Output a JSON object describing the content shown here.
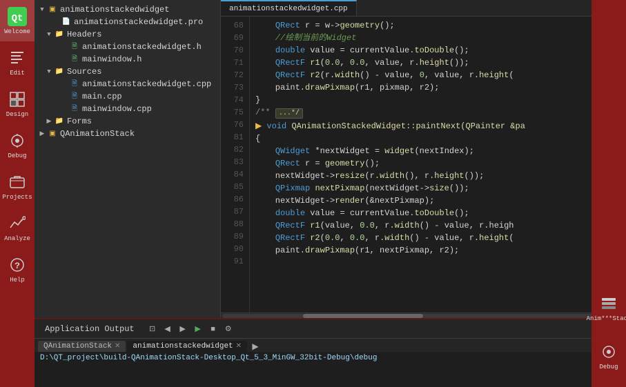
{
  "sidebar": {
    "items": [
      {
        "label": "Welcome",
        "icon": "qt-logo"
      },
      {
        "label": "Edit",
        "icon": "edit-icon"
      },
      {
        "label": "Design",
        "icon": "design-icon"
      },
      {
        "label": "Debug",
        "icon": "debug-icon"
      },
      {
        "label": "Projects",
        "icon": "projects-icon"
      },
      {
        "label": "Analyze",
        "icon": "analyze-icon"
      },
      {
        "label": "Help",
        "icon": "help-icon"
      }
    ]
  },
  "fileTree": {
    "items": [
      {
        "label": "animationstackedwidget",
        "type": "project",
        "depth": 0,
        "expanded": true,
        "arrow": "▼"
      },
      {
        "label": "animationstackedwidget.pro",
        "type": "pro",
        "depth": 1,
        "expanded": false,
        "arrow": ""
      },
      {
        "label": "Headers",
        "type": "folder",
        "depth": 1,
        "expanded": true,
        "arrow": "▼"
      },
      {
        "label": "animationstackedwidget.h",
        "type": "h",
        "depth": 2,
        "expanded": false,
        "arrow": ""
      },
      {
        "label": "mainwindow.h",
        "type": "h",
        "depth": 2,
        "expanded": false,
        "arrow": ""
      },
      {
        "label": "Sources",
        "type": "folder",
        "depth": 1,
        "expanded": true,
        "arrow": "▼"
      },
      {
        "label": "animationstackedwidget.cpp",
        "type": "cpp",
        "depth": 2,
        "expanded": false,
        "arrow": ""
      },
      {
        "label": "main.cpp",
        "type": "cpp",
        "depth": 2,
        "expanded": false,
        "arrow": ""
      },
      {
        "label": "mainwindow.cpp",
        "type": "cpp",
        "depth": 2,
        "expanded": false,
        "arrow": ""
      },
      {
        "label": "Forms",
        "type": "folder",
        "depth": 1,
        "expanded": false,
        "arrow": "▶"
      },
      {
        "label": "QAnimationStack",
        "type": "project",
        "depth": 0,
        "expanded": false,
        "arrow": "▶"
      }
    ]
  },
  "editor": {
    "activeTab": "animationstackedwidget.cpp",
    "tabs": [
      "animationstackedwidget.cpp"
    ],
    "lines": [
      {
        "num": 68,
        "code": "    QRect r = w->geometry();"
      },
      {
        "num": 69,
        "code": "    //绘制当前的Widget",
        "comment": true
      },
      {
        "num": 70,
        "code": "    double value = currentValue.toDouble();"
      },
      {
        "num": 71,
        "code": "    QRectF r1(0.0, 0.0, value, r.height());"
      },
      {
        "num": 72,
        "code": "    QRectF r2(r.width() - value, 0, value, r.height("
      },
      {
        "num": 73,
        "code": "    paint.drawPixmap(r1, pixmap, r2);"
      },
      {
        "num": 74,
        "code": "}"
      },
      {
        "num": 75,
        "code": ""
      },
      {
        "num": 76,
        "code": "/**",
        "fold": true,
        "foldLabel": "...*/"
      },
      {
        "num": 81,
        "code": "▶ void QAnimationStackedWidget::paintNext(QPainter &pa"
      },
      {
        "num": 82,
        "code": "{"
      },
      {
        "num": 83,
        "code": "    QWidget *nextWidget = widget(nextIndex);"
      },
      {
        "num": 84,
        "code": "    QRect r = geometry();"
      },
      {
        "num": 85,
        "code": "    nextWidget->resize(r.width(), r.height());"
      },
      {
        "num": 86,
        "code": "    QPixmap nextPixmap(nextWidget->size());"
      },
      {
        "num": 87,
        "code": "    nextWidget->render(&nextPixmap);"
      },
      {
        "num": 88,
        "code": "    double value = currentValue.toDouble();"
      },
      {
        "num": 89,
        "code": "    QRectF r1(value, 0.0, r.width() - value, r.heigh"
      },
      {
        "num": 90,
        "code": "    QRectF r2(0.0, 0.0, r.width() - value, r.height("
      },
      {
        "num": 91,
        "code": "    paint.drawPixmap(r1, nextPixmap, r2);"
      }
    ]
  },
  "outputPanel": {
    "title": "Application Output",
    "tabs": [
      {
        "label": "QAnimationStack",
        "active": false
      },
      {
        "label": "animationstackedwidget",
        "active": true
      }
    ],
    "content": "D:\\QT_project\\build-QAnimationStack-Desktop_Qt_5_3_MinGW_32bit-Debug\\debug"
  },
  "bottomSidebar": {
    "items": [
      {
        "label": "Anim***Stack",
        "icon": "anim-icon"
      },
      {
        "label": "Debug",
        "icon": "debug-icon2"
      }
    ]
  }
}
